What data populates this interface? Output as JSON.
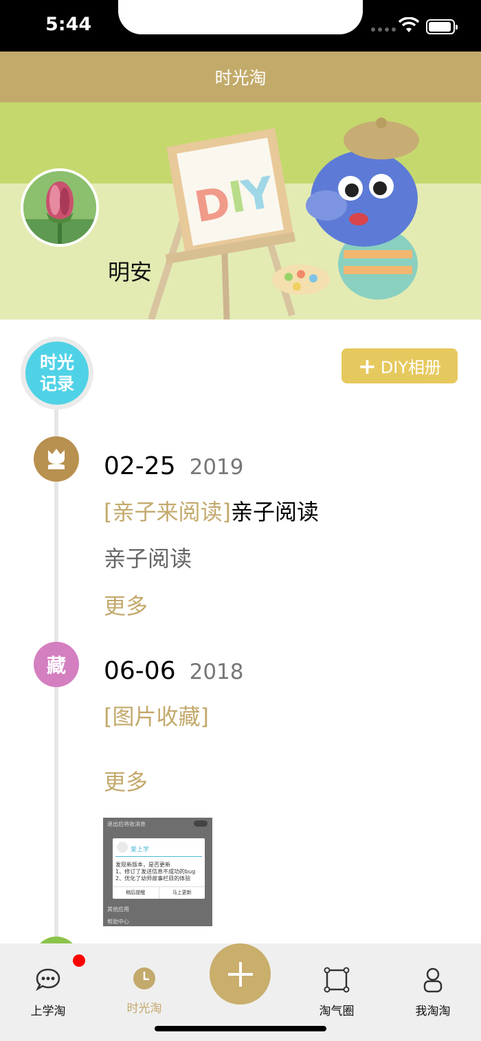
{
  "status_bar": {
    "time": "5:44"
  },
  "nav": {
    "title": "时光淘"
  },
  "profile": {
    "name": "明安"
  },
  "timeline": {
    "record_badge": "时光记录",
    "diy_button": "DIY相册",
    "entries": [
      {
        "icon": "tulip-icon",
        "icon_color": "#b8904f",
        "date": "02-25",
        "year": "2019",
        "tag": "[亲子来阅读]",
        "title": "亲子阅读",
        "body": "亲子阅读",
        "more": "更多"
      },
      {
        "icon_text": "藏",
        "icon_color": "#d47fc0",
        "date": "06-06",
        "year": "2018",
        "tag": "[图片收藏]",
        "title": "",
        "more": "更多",
        "thumbnail": {
          "top_row": "退出后将收消息",
          "dialog_title": "爱上学",
          "line1": "发现新版本，是否更新",
          "line2": "1、修订了发送信息不成功的bug",
          "line3": "2、优化了幼师故事栏目的体验",
          "btn_later": "稍后提醒",
          "btn_update": "马上更新",
          "row_other": "其他应用",
          "row_help": "帮助中心"
        }
      }
    ]
  },
  "tabs": [
    {
      "label": "上学淘",
      "icon": "chat-bubble-icon",
      "has_badge": true
    },
    {
      "label": "时光淘",
      "icon": "clock-icon",
      "active": true
    },
    {
      "label": "",
      "icon": "plus-icon"
    },
    {
      "label": "淘气圈",
      "icon": "square-frame-icon"
    },
    {
      "label": "我淘淘",
      "icon": "person-icon"
    }
  ],
  "colors": {
    "nav_bg": "#c2aa6a",
    "accent_gold": "#c3a96c",
    "diy_button": "#e6c95e",
    "record_badge": "#50d2e6"
  }
}
